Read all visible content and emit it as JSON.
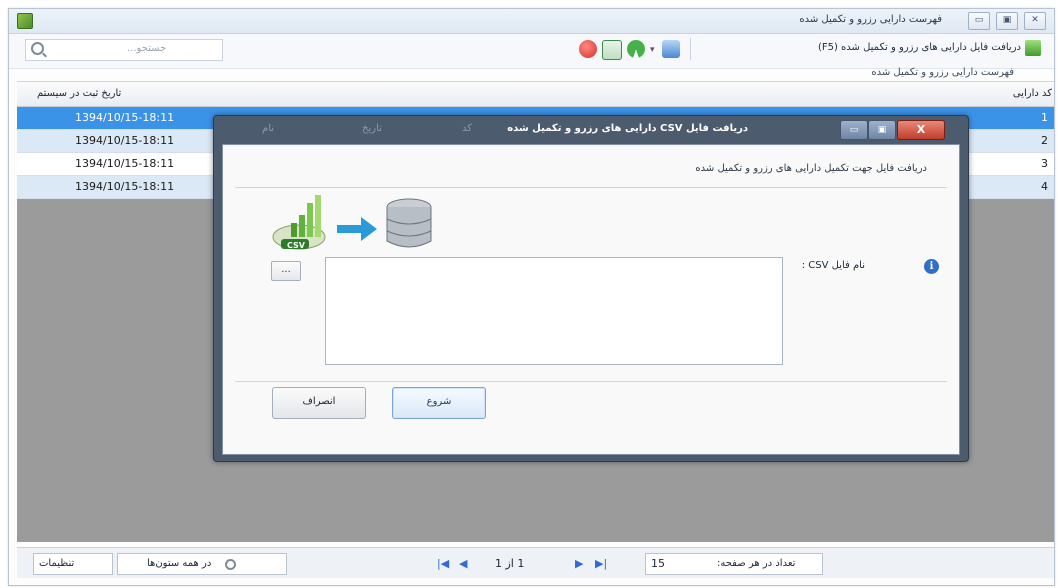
{
  "window": {
    "title": "فهرست دارایی رزرو و تکمیل شده",
    "min": "▭",
    "max": "▣",
    "close": "✕"
  },
  "toolbar": {
    "search_placeholder": "جستجو...",
    "download_label": "دریافت فایل دارایی های رزرو و تکمیل شده (F5)",
    "subheading": "فهرست دارایی رزرو و تکمیل شده"
  },
  "grid": {
    "columns": {
      "registered_at": "تاریخ ثبت در سیستم",
      "code": "کد دارایی"
    },
    "rows": [
      {
        "n": "1",
        "date": "1394/10/15-18:11",
        "selected": true
      },
      {
        "n": "2",
        "date": "1394/10/15-18:11",
        "selected": false
      },
      {
        "n": "3",
        "date": "1394/10/15-18:11",
        "selected": false
      },
      {
        "n": "4",
        "date": "1394/10/15-18:11",
        "selected": false
      }
    ]
  },
  "pager": {
    "changes_label": "تنظیمات",
    "all_columns_label": "در همه ستون‌ها",
    "page_info": "1 از 1",
    "per_page_label": "تعداد در هر صفحه:",
    "per_page_value": "15",
    "first": "|◀",
    "prev": "◀",
    "next": "▶",
    "last": "▶|"
  },
  "dialog": {
    "title": "دریافت فایل CSV دارایی های رزرو و تکمیل شده",
    "ghost_headers": [
      "کد دارایی",
      "کد",
      "تاریخ",
      "نام"
    ],
    "description": "دریافت فایل جهت تکمیل دارایی های رزرو و تکمیل شده",
    "csv_badge": "CSV",
    "file_label": "نام فایل CSV :",
    "browse": "...",
    "info": "i",
    "start_button": "شروع",
    "cancel_button": "انصراف",
    "close": "X",
    "min": "▭",
    "max": "▣"
  },
  "colors": {
    "selected_row": "#3b93e8",
    "alt_row": "#dbe8f6",
    "grid_bg": "#9b9b9b",
    "dialog_frame": "#4d5b6e"
  }
}
